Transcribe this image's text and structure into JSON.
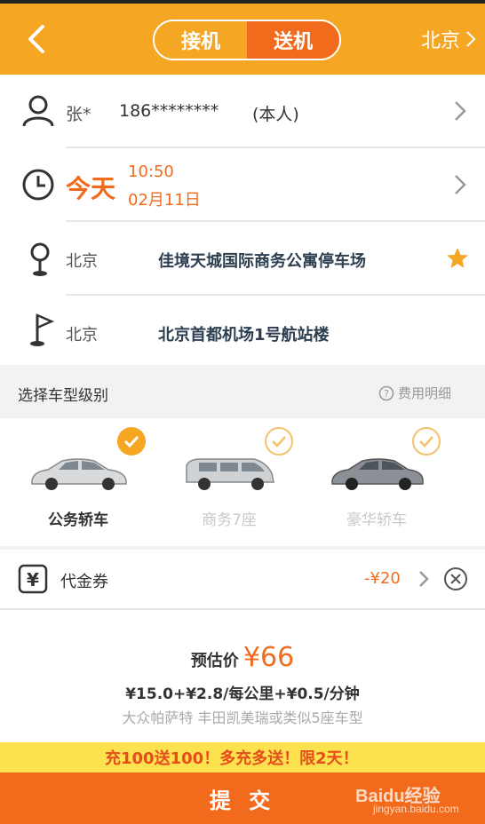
{
  "header": {
    "tabs": [
      {
        "label": "接机",
        "active": false
      },
      {
        "label": "送机",
        "active": true
      }
    ],
    "city": "北京"
  },
  "passenger": {
    "name": "张*",
    "phone": "186********",
    "tag": "(本人)"
  },
  "time": {
    "day": "今天",
    "clock": "10:50",
    "date": "02月11日"
  },
  "from": {
    "city": "北京",
    "place": "佳境天城国际商务公寓停车场"
  },
  "to": {
    "city": "北京",
    "place": "北京首都机场1号航站楼"
  },
  "car_section": {
    "title": "选择车型级别",
    "fee_detail": "费用明细"
  },
  "cars": [
    {
      "label": "公务轿车",
      "selected": true
    },
    {
      "label": "商务7座",
      "selected": false
    },
    {
      "label": "豪华轿车",
      "selected": false
    }
  ],
  "coupon": {
    "label": "代金券",
    "amount": "-¥20"
  },
  "estimate": {
    "prefix": "预估价",
    "price": "¥66",
    "formula": "¥15.0+¥2.8/每公里+¥0.5/分钟",
    "models": "大众帕萨特 丰田凯美瑞或类似5座车型"
  },
  "banner": "充100送100！多充多送！限2天！",
  "submit_label": "提 交",
  "watermark": {
    "brand": "Baidu经验",
    "url": "jingyan.baidu.com"
  },
  "colors": {
    "accent": "#f5a623",
    "primary": "#f26b1d",
    "banner": "#fde24f"
  }
}
